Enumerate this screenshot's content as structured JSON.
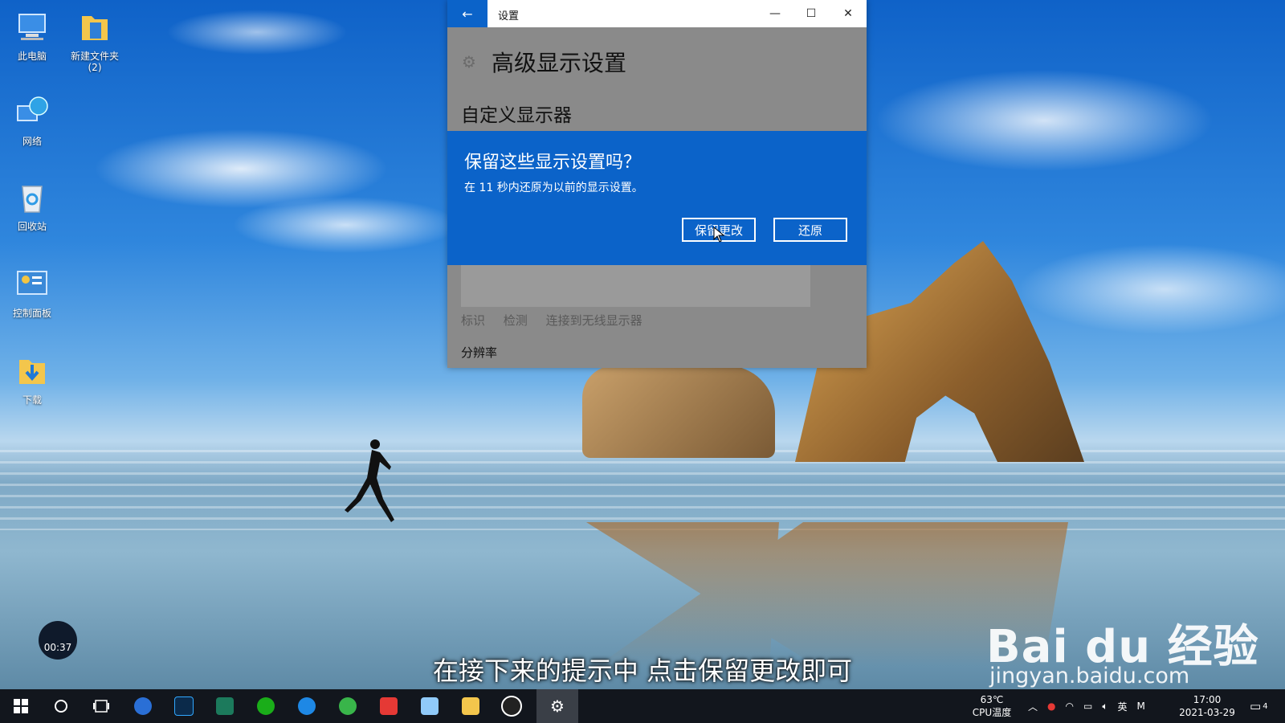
{
  "desktop": {
    "icons": [
      {
        "label": "此电脑"
      },
      {
        "label": "新建文件夹",
        "sublabel": "(2)"
      },
      {
        "label": "网络"
      },
      {
        "label": "回收站"
      },
      {
        "label": "控制面板"
      },
      {
        "label": "下载"
      }
    ]
  },
  "settings_window": {
    "title": "设置",
    "back_symbol": "←",
    "controls": {
      "minimize": "—",
      "maximize": "☐",
      "close": "✕"
    },
    "page_title": "高级显示设置",
    "section_title": "自定义显示器",
    "links": [
      "标识",
      "检测",
      "连接到无线显示器"
    ],
    "resolution_label": "分辨率"
  },
  "dialog": {
    "title": "保留这些显示设置吗？",
    "message": "在 11 秒内还原为以前的显示设置。",
    "keep_label": "保留更改",
    "revert_label": "还原"
  },
  "overlay": {
    "timer": "00:37",
    "subtitle": "在接下来的提示中 点击保留更改即可",
    "watermark": "Bai du 经验",
    "watermark_url": "jingyan.baidu.com"
  },
  "taskbar": {
    "cpu_temp": "63℃",
    "cpu_label": "CPU温度",
    "ime": "英",
    "time": "17:00",
    "date": "2021-03-29",
    "notification_count": "4",
    "colors": {
      "background": "#12161d",
      "accent": "#0b63c9"
    }
  }
}
